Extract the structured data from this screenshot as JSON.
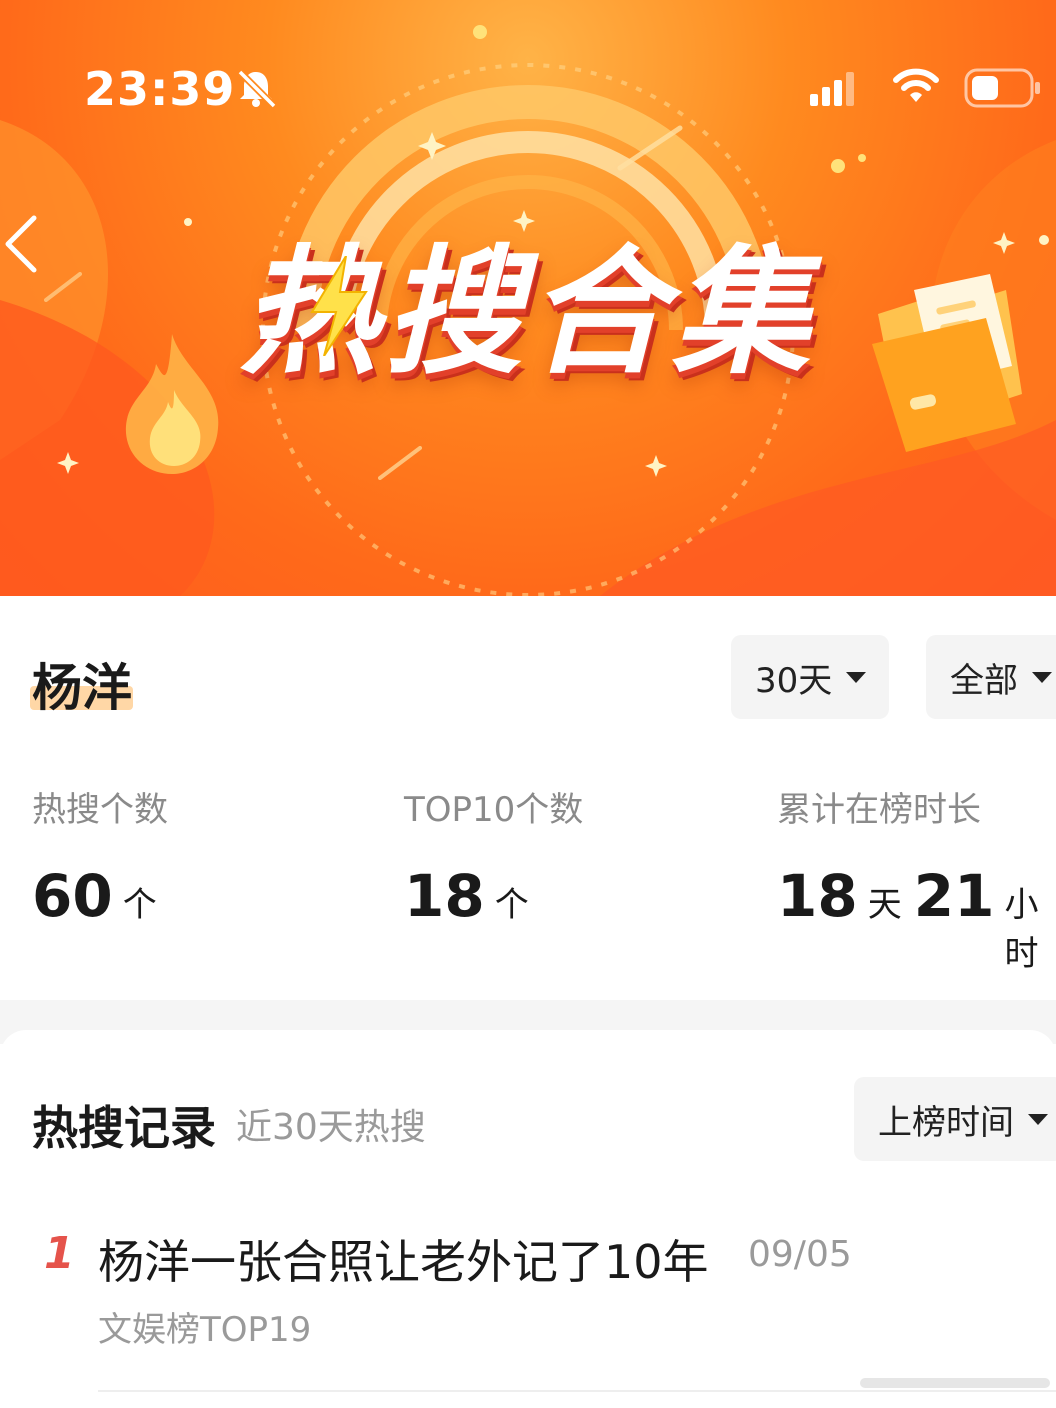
{
  "status_bar": {
    "time": "23:39",
    "icons": [
      "bell-off-icon",
      "signal-icon",
      "wifi-icon",
      "battery-icon"
    ]
  },
  "banner": {
    "title": "热搜合集",
    "back_icon": "chevron-left-icon",
    "decor_icons": [
      "flame-icon",
      "folder-icon",
      "lightning-icon"
    ],
    "colors": {
      "primary": "#ff6a1a",
      "glow": "#ffb347",
      "shadow": "#e2402a"
    }
  },
  "summary": {
    "name": "杨洋",
    "filters": {
      "days": "30天",
      "scope": "全部"
    },
    "stats": [
      {
        "label": "热搜个数",
        "value": "60",
        "unit": "个"
      },
      {
        "label": "TOP10个数",
        "value": "18",
        "unit": "个"
      },
      {
        "label": "累计在榜时长",
        "value1": "18",
        "unit1": "天",
        "value2": "21",
        "unit2": "小时"
      }
    ]
  },
  "records": {
    "title": "热搜记录",
    "subtitle": "近30天热搜",
    "sort_label": "上榜时间",
    "items": [
      {
        "rank": "1",
        "title": "杨洋一张合照让老外记了10年",
        "date": "09/05",
        "tag": "文娱榜TOP19"
      }
    ]
  }
}
